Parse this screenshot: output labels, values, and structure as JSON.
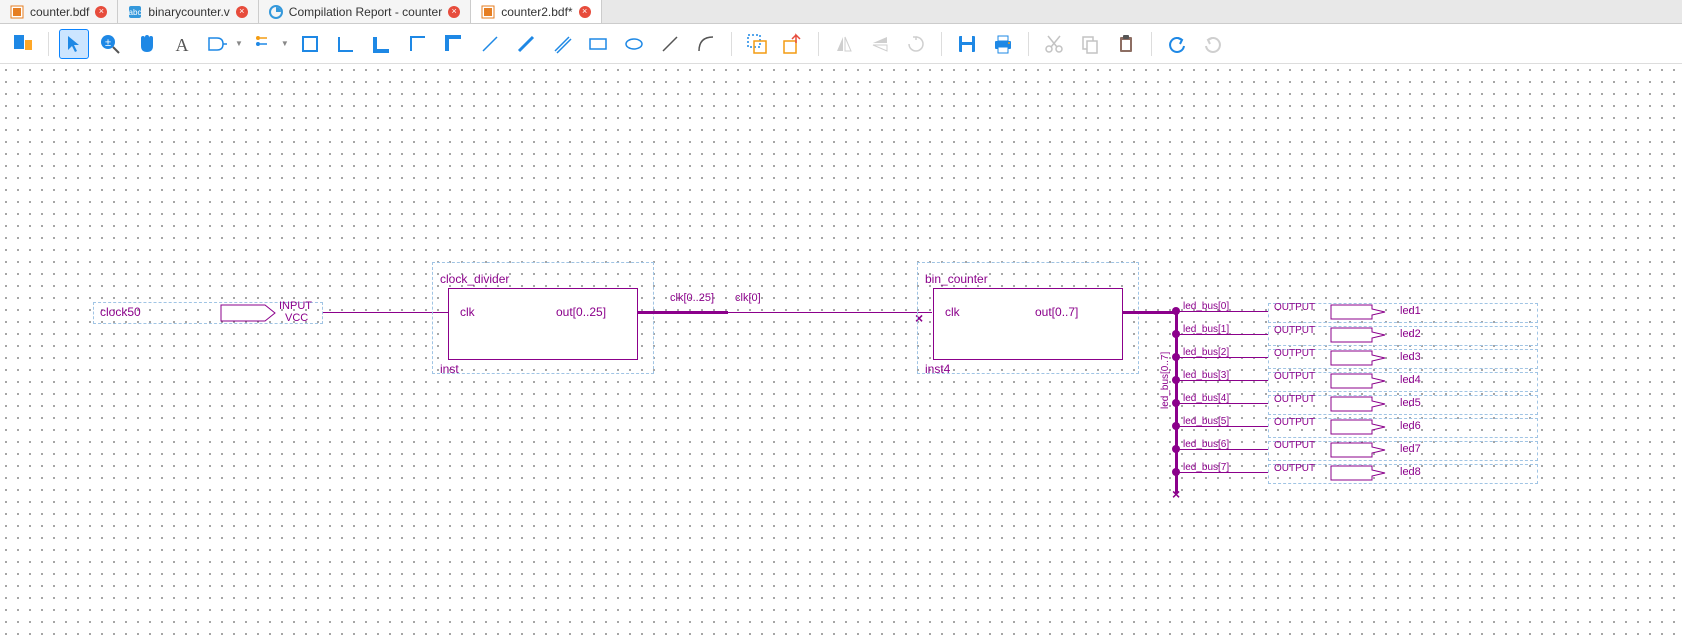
{
  "tabs": [
    {
      "label": "counter.bdf",
      "icon": "bdf"
    },
    {
      "label": "binarycounter.v",
      "icon": "verilog"
    },
    {
      "label": "Compilation Report - counter",
      "icon": "report"
    },
    {
      "label": "counter2.bdf*",
      "icon": "bdf",
      "active": true
    }
  ],
  "input_pin": {
    "name": "clock50",
    "type": "INPUT",
    "tie": "VCC"
  },
  "blocks": {
    "divider": {
      "title": "clock_divider",
      "port_in": "clk",
      "port_out": "out[0..25]",
      "inst": "inst"
    },
    "counter": {
      "title": "bin_counter",
      "port_in": "clk",
      "port_out": "out[0..7]",
      "inst": "inst4"
    }
  },
  "nets": {
    "mid_left": "clk[0..25]",
    "mid_right": "clk[0]"
  },
  "bus_lines": [
    {
      "tag": "led_bus[0]",
      "out": "OUTPUT",
      "name": "led1"
    },
    {
      "tag": "led_bus[1]",
      "out": "OUTPUT",
      "name": "led2"
    },
    {
      "tag": "led_bus[2]",
      "out": "OUTPUT",
      "name": "led3"
    },
    {
      "tag": "led_bus[3]",
      "out": "OUTPUT",
      "name": "led4"
    },
    {
      "tag": "led_bus[4]",
      "out": "OUTPUT",
      "name": "led5"
    },
    {
      "tag": "led_bus[5]",
      "out": "OUTPUT",
      "name": "led6"
    },
    {
      "tag": "led_bus[6]",
      "out": "OUTPUT",
      "name": "led7"
    },
    {
      "tag": "led_bus[7]",
      "out": "OUTPUT",
      "name": "led8"
    }
  ],
  "bus_stub": "led_bus[0..7]"
}
